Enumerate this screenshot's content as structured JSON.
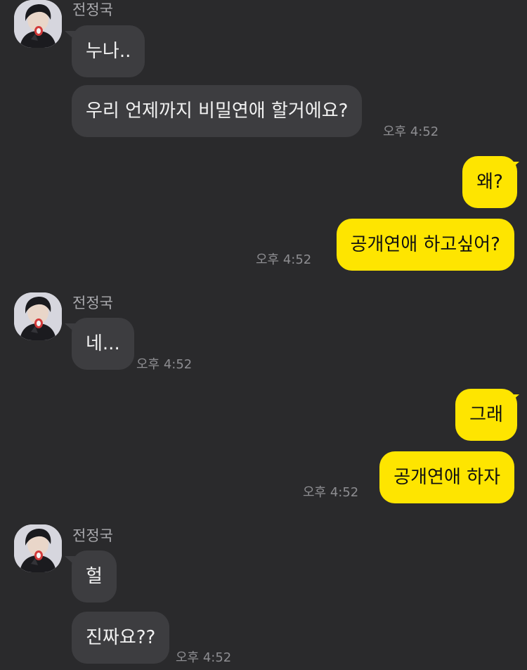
{
  "chat": {
    "groups": [
      {
        "sender": "전정국",
        "messages": [
          "누나..",
          "우리 언제까지 비밀연애 할거에요?"
        ],
        "time": "오후 4:52"
      },
      {
        "me": true,
        "messages": [
          "왜?",
          "공개연애 하고싶어?"
        ],
        "time": "오후 4:52"
      },
      {
        "sender": "전정국",
        "messages": [
          "네..."
        ],
        "time": "오후 4:52"
      },
      {
        "me": true,
        "messages": [
          "그래",
          "공개연애 하자"
        ],
        "time": "오후 4:52"
      },
      {
        "sender": "전정국",
        "messages": [
          "헐",
          "진짜요??"
        ],
        "time": "오후 4:52"
      }
    ]
  },
  "colors": {
    "background": "#2a2a2c",
    "incoming_bubble": "#3d3d40",
    "outgoing_bubble": "#fee500"
  },
  "avatar_icon": "profile-photo"
}
